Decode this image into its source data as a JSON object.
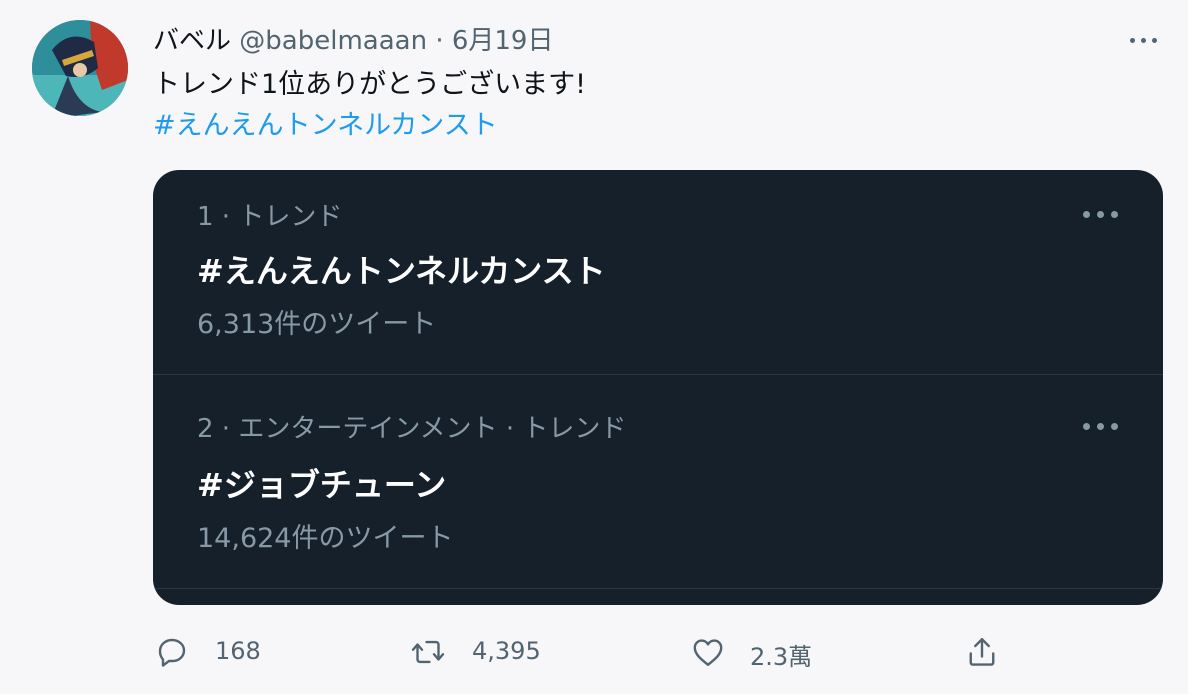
{
  "tweet": {
    "author_name": "バベル",
    "author_handle": "@babelmaaan",
    "separator": "·",
    "date": "6月19日",
    "text": "トレンド1位ありがとうございます!",
    "hashtag": "#えんえんトンネルカンスト"
  },
  "trends": [
    {
      "rank_meta": "1 · トレンド",
      "title": "#えんえんトンネルカンスト",
      "count": "6,313件のツイート"
    },
    {
      "rank_meta": "2 · エンターテインメント · トレンド",
      "title": "#ジョブチューン",
      "count": "14,624件のツイート"
    }
  ],
  "actions": {
    "replies": "168",
    "retweets": "4,395",
    "likes": "2.3萬"
  },
  "icons": {
    "more": "more-horizontal-icon",
    "reply": "reply-bubble-icon",
    "retweet": "retweet-icon",
    "like": "heart-icon",
    "share": "share-icon"
  },
  "colors": {
    "link": "#1d9bf0",
    "card_bg": "#15202b",
    "muted": "#536471"
  }
}
